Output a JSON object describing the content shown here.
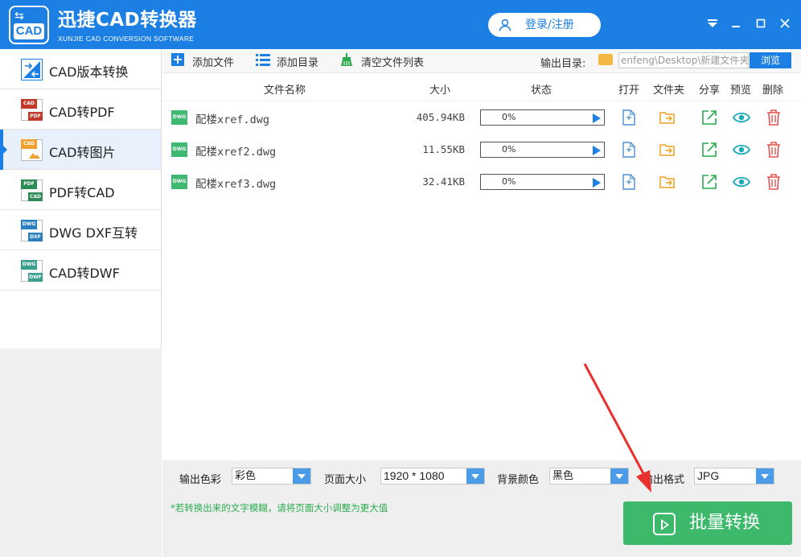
{
  "app": {
    "title": "迅捷CAD转换器",
    "subtitle": "XUNJIE CAD CONVERSION SOFTWARE",
    "logo_text": "CAD",
    "login_label": "登录/注册"
  },
  "window_controls": [
    "menu-icon",
    "minimize-icon",
    "maximize-icon",
    "close-icon"
  ],
  "sidebar": {
    "active_index": 2,
    "items": [
      {
        "label": "CAD版本转换",
        "icon": "cad-version-icon"
      },
      {
        "label": "CAD转PDF",
        "icon": "cad-to-pdf-icon",
        "badge_top": "CAD",
        "badge_bottom": "PDF"
      },
      {
        "label": "CAD转图片",
        "icon": "cad-to-image-icon",
        "badge_top": "CAD"
      },
      {
        "label": "PDF转CAD",
        "icon": "pdf-to-cad-icon",
        "badge_top": "PDF",
        "badge_bottom": "CAD"
      },
      {
        "label": "DWG DXF互转",
        "icon": "dwg-dxf-icon",
        "badge_top": "DWG",
        "badge_bottom": "DXF"
      },
      {
        "label": "CAD转DWF",
        "icon": "cad-to-dwf-icon",
        "badge_top": "DWG",
        "badge_bottom": "DWF"
      }
    ]
  },
  "toolbar": {
    "add_file": "添加文件",
    "add_folder": "添加目录",
    "clear_list": "清空文件列表",
    "output_label": "输出目录:",
    "output_path": "enfeng\\Desktop\\新建文件夹",
    "browse": "浏览"
  },
  "table": {
    "headers": {
      "name": "文件名称",
      "size": "大小",
      "status": "状态",
      "open": "打开",
      "folder": "文件夹",
      "share": "分享",
      "preview": "预览",
      "delete": "删除"
    },
    "rows": [
      {
        "icon_text": "DWG",
        "name": "配楼xref.dwg",
        "size": "405.94KB",
        "progress": "0%"
      },
      {
        "icon_text": "DWG",
        "name": "配楼xref2.dwg",
        "size": "11.55KB",
        "progress": "0%"
      },
      {
        "icon_text": "DWG",
        "name": "配楼xref3.dwg",
        "size": "32.41KB",
        "progress": "0%"
      }
    ]
  },
  "options": {
    "color_label": "输出色彩",
    "color_value": "彩色",
    "page_size_label": "页面大小",
    "page_size_value": "1920 * 1080",
    "bg_label": "背景颜色",
    "bg_value": "黑色",
    "format_label": "输出格式",
    "format_value": "JPG"
  },
  "hint": "*若转换出来的文字模糊，请将页面大小调整为更大值",
  "convert_button": "批量转换",
  "colors": {
    "brand_blue": "#1c7fe3",
    "convert_green": "#3cb96b",
    "hint_green": "#2bab4e",
    "annotation_red": "#e8302c"
  }
}
